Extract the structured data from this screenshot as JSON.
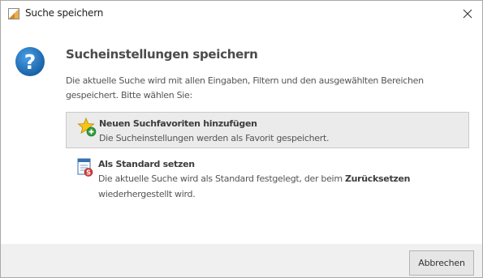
{
  "window": {
    "title": "Suche speichern",
    "app_icon": "document-icon",
    "close_icon": "close-icon"
  },
  "dialog": {
    "icon": "question-icon",
    "heading": "Sucheinstellungen speichern",
    "description": "Die aktuelle Suche wird mit allen Eingaben, Filtern und den ausgewählten Bereichen gespeichert. Bitte wählen Sie:"
  },
  "options": [
    {
      "icon": "star-add-icon",
      "title": "Neuen Suchfavoriten hinzufügen",
      "description": "Die Sucheinstellungen werden als Favorit gespeichert.",
      "selected": true
    },
    {
      "icon": "standard-document-icon",
      "title": "Als Standard setzen",
      "description_before": "Die aktuelle Suche wird als Standard festgelegt, der beim ",
      "description_bold": "Zurücksetzen",
      "description_after": " wiederhergestellt wird.",
      "selected": false
    }
  ],
  "footer": {
    "cancel_label": "Abbrechen"
  },
  "colors": {
    "question_blue": "#1f6fb5",
    "selected_bg": "#ebebeb",
    "footer_bg": "#f0f0f0"
  }
}
